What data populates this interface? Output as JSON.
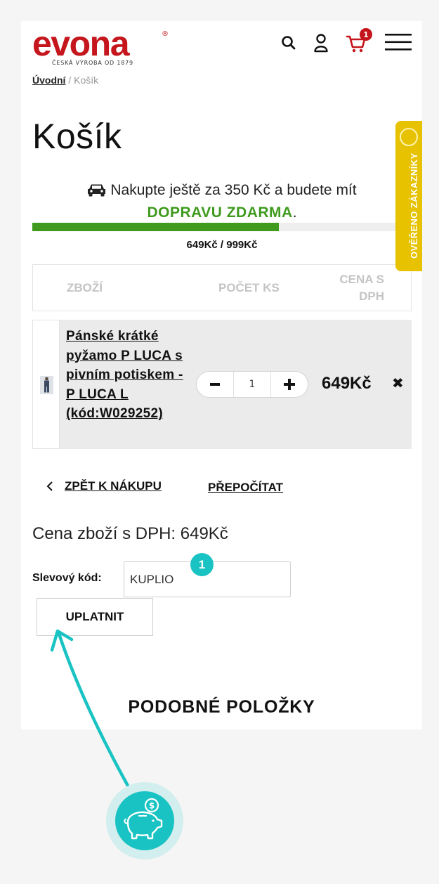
{
  "header": {
    "logo_text": "evona",
    "logo_reg": "®",
    "tagline": "ČESKÁ VÝROBA OD 1879",
    "icons": [
      "search-icon",
      "user-icon",
      "cart-icon",
      "menu-icon"
    ],
    "cart_count": "1"
  },
  "breadcrumb": {
    "home": "Úvodní",
    "separator": "/",
    "current": "Košík"
  },
  "page_title": "Košík",
  "shipping": {
    "message": "Nakupte ještě za 350 Kč a budete mít",
    "highlight": "DOPRAVU ZDARMA",
    "suffix": ".",
    "progress_fraction": 0.65,
    "progress_text": "649Kč / 999Kč"
  },
  "table": {
    "headers": [
      "ZBOŽÍ",
      "POČET KS",
      "CENA S DPH"
    ],
    "rows": [
      {
        "name": "Pánské krátké pyžamo P LUCA s pivním potiskem - P LUCA L (kód:W029252)",
        "quantity": "1",
        "price": "649Kč",
        "remove": "✖"
      }
    ]
  },
  "actions": {
    "back": "ZPĚT K NÁKUPU",
    "recalculate": "PŘEPOČÍTAT"
  },
  "total": "Cena zboží s DPH: 649Kč",
  "promo": {
    "label": "Slevový kód:",
    "value": "KUPLIO",
    "apply": "UPLATNIT"
  },
  "similar_heading": "PODOBNÉ POLOŽKY",
  "side_badge": "OVĚŘENO ZÁKAZNÍKY",
  "annotation": {
    "step": "1"
  },
  "colors": {
    "brand": "#c4161c",
    "accent_green": "#3f9a1e",
    "teal": "#19c3c3",
    "badge_yellow": "#e6c200"
  }
}
